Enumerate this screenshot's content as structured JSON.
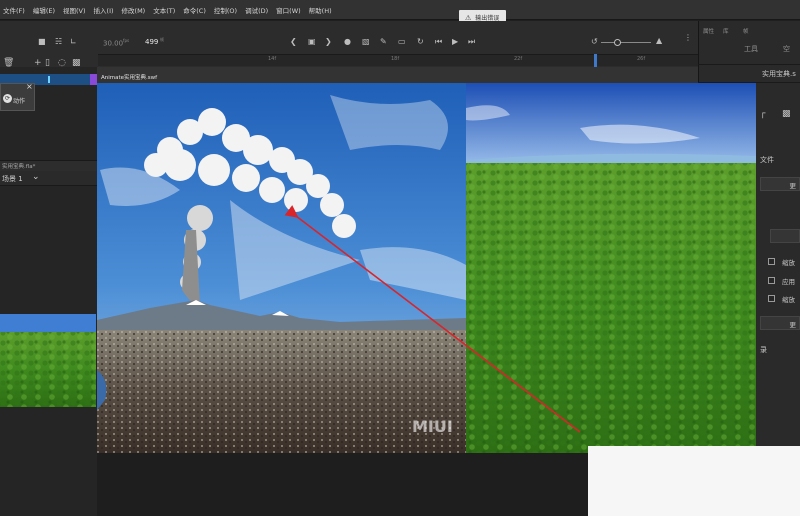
{
  "menu": {
    "items": [
      "文件(F)",
      "编辑(E)",
      "视图(V)",
      "插入(I)",
      "修改(M)",
      "文本(T)",
      "命令(C)",
      "控制(O)",
      "调试(D)",
      "窗口(W)",
      "帮助(H)"
    ]
  },
  "error_badge": {
    "label": "输出错误"
  },
  "toolbar": {
    "fps": "30.00",
    "fps_unit": "fps",
    "frame": "499",
    "frame_unit": "帧",
    "ruler_ticks": [
      "14f",
      "18f",
      "22f",
      "26f"
    ],
    "icons": [
      "camera-icon",
      "layers-icon",
      "graph-icon",
      "prev-keyframe-icon",
      "stop-icon",
      "rewind-icon",
      "play-icon",
      "forward-icon",
      "loop-icon",
      "zoom-out-icon",
      "zoom-in-icon"
    ]
  },
  "left": {
    "layer_tools": [
      "trash-icon",
      "add-icon",
      "phone-icon",
      "eye-icon",
      "lock-icon"
    ],
    "actions_label": "动作",
    "library_tab": "实用宝典.fla*",
    "scene_label": "场景 1"
  },
  "stage": {
    "document_tab": "Animate实用宝典.swf"
  },
  "properties": {
    "tabs": [
      "属性",
      "库",
      "帧"
    ],
    "tool_label": "工具",
    "tab_right": "空",
    "doc_label": "实用宝典.s",
    "file_label": "文件",
    "button_label": "更",
    "checkbox_labels": [
      "缩放",
      "应用",
      "缩放"
    ],
    "record_label": "录"
  },
  "watermark": "MIUI",
  "annotation": {
    "color": "#d9242a"
  }
}
